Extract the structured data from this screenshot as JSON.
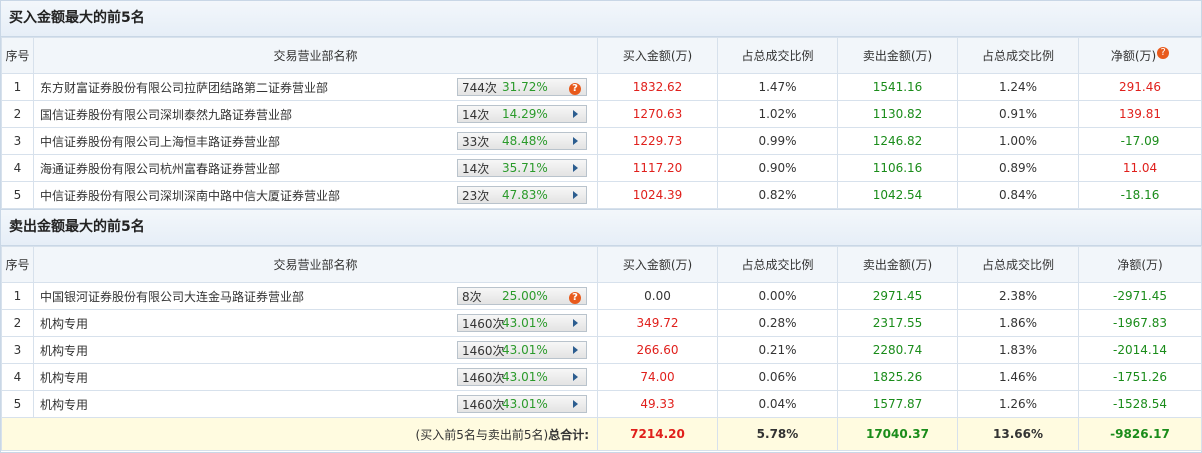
{
  "buy_section": {
    "title": "买入金额最大的前5名",
    "headers": [
      "序号",
      "交易营业部名称",
      "买入金额(万)",
      "占总成交比例",
      "卖出金额(万)",
      "占总成交比例",
      "净额(万)"
    ],
    "rows": [
      {
        "idx": "1",
        "name": "东方财富证券股份有限公司拉萨团结路第二证券营业部",
        "count": "744次",
        "pct": "31.72%",
        "icon": "question-icon",
        "buy": "1832.62",
        "buy_ratio": "1.47%",
        "sell": "1541.16",
        "sell_ratio": "1.24%",
        "net": "291.46",
        "net_color": "red"
      },
      {
        "idx": "2",
        "name": "国信证券股份有限公司深圳泰然九路证券营业部",
        "count": "14次",
        "pct": "14.29%",
        "icon": "arrow-icon",
        "buy": "1270.63",
        "buy_ratio": "1.02%",
        "sell": "1130.82",
        "sell_ratio": "0.91%",
        "net": "139.81",
        "net_color": "red"
      },
      {
        "idx": "3",
        "name": "中信证券股份有限公司上海恒丰路证券营业部",
        "count": "33次",
        "pct": "48.48%",
        "icon": "arrow-icon",
        "buy": "1229.73",
        "buy_ratio": "0.99%",
        "sell": "1246.82",
        "sell_ratio": "1.00%",
        "net": "-17.09",
        "net_color": "green"
      },
      {
        "idx": "4",
        "name": "海通证券股份有限公司杭州富春路证券营业部",
        "count": "14次",
        "pct": "35.71%",
        "icon": "arrow-icon",
        "buy": "1117.20",
        "buy_ratio": "0.90%",
        "sell": "1106.16",
        "sell_ratio": "0.89%",
        "net": "11.04",
        "net_color": "red"
      },
      {
        "idx": "5",
        "name": "中信证券股份有限公司深圳深南中路中信大厦证券营业部",
        "count": "23次",
        "pct": "47.83%",
        "icon": "arrow-icon",
        "buy": "1024.39",
        "buy_ratio": "0.82%",
        "sell": "1042.54",
        "sell_ratio": "0.84%",
        "net": "-18.16",
        "net_color": "green"
      }
    ]
  },
  "sell_section": {
    "title": "卖出金额最大的前5名",
    "headers": [
      "序号",
      "交易营业部名称",
      "买入金额(万)",
      "占总成交比例",
      "卖出金额(万)",
      "占总成交比例",
      "净额(万)"
    ],
    "rows": [
      {
        "idx": "1",
        "name": "中国银河证券股份有限公司大连金马路证券营业部",
        "count": "8次",
        "pct": "25.00%",
        "icon": "question-icon",
        "buy": "0.00",
        "buy_ratio": "0.00%",
        "sell": "2971.45",
        "sell_ratio": "2.38%",
        "net": "-2971.45",
        "net_color": "green"
      },
      {
        "idx": "2",
        "name": "机构专用",
        "count": "1460次",
        "pct": "43.01%",
        "icon": "arrow-icon",
        "buy": "349.72",
        "buy_ratio": "0.28%",
        "sell": "2317.55",
        "sell_ratio": "1.86%",
        "net": "-1967.83",
        "net_color": "green"
      },
      {
        "idx": "3",
        "name": "机构专用",
        "count": "1460次",
        "pct": "43.01%",
        "icon": "arrow-icon",
        "buy": "266.60",
        "buy_ratio": "0.21%",
        "sell": "2280.74",
        "sell_ratio": "1.83%",
        "net": "-2014.14",
        "net_color": "green"
      },
      {
        "idx": "4",
        "name": "机构专用",
        "count": "1460次",
        "pct": "43.01%",
        "icon": "arrow-icon",
        "buy": "74.00",
        "buy_ratio": "0.06%",
        "sell": "1825.26",
        "sell_ratio": "1.46%",
        "net": "-1751.26",
        "net_color": "green"
      },
      {
        "idx": "5",
        "name": "机构专用",
        "count": "1460次",
        "pct": "43.01%",
        "icon": "arrow-icon",
        "buy": "49.33",
        "buy_ratio": "0.04%",
        "sell": "1577.87",
        "sell_ratio": "1.26%",
        "net": "-1528.54",
        "net_color": "green"
      }
    ]
  },
  "total": {
    "label_prefix": "(买入前5名与卖出前5名)",
    "label_bold": "总合计:",
    "buy": "7214.20",
    "buy_ratio": "5.78%",
    "sell": "17040.37",
    "sell_ratio": "13.66%",
    "net": "-9826.17"
  },
  "colors": {
    "red": "#e0201c",
    "green": "#1a8c1a",
    "accent": "#2c5d8f",
    "icon_orange": "#e85a1c"
  }
}
